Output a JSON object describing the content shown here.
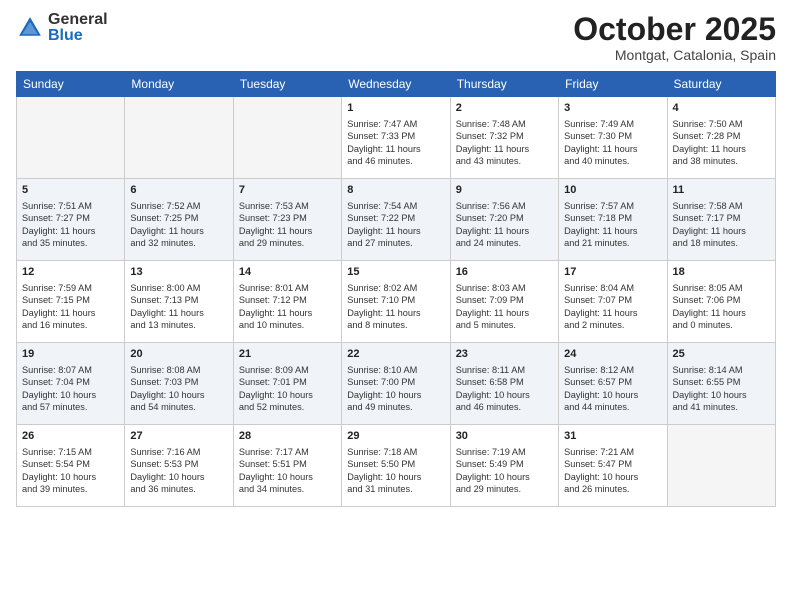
{
  "header": {
    "logo_general": "General",
    "logo_blue": "Blue",
    "month_title": "October 2025",
    "location": "Montgat, Catalonia, Spain"
  },
  "weekdays": [
    "Sunday",
    "Monday",
    "Tuesday",
    "Wednesday",
    "Thursday",
    "Friday",
    "Saturday"
  ],
  "weeks": [
    [
      {
        "day": "",
        "info": ""
      },
      {
        "day": "",
        "info": ""
      },
      {
        "day": "",
        "info": ""
      },
      {
        "day": "1",
        "info": "Sunrise: 7:47 AM\nSunset: 7:33 PM\nDaylight: 11 hours\nand 46 minutes."
      },
      {
        "day": "2",
        "info": "Sunrise: 7:48 AM\nSunset: 7:32 PM\nDaylight: 11 hours\nand 43 minutes."
      },
      {
        "day": "3",
        "info": "Sunrise: 7:49 AM\nSunset: 7:30 PM\nDaylight: 11 hours\nand 40 minutes."
      },
      {
        "day": "4",
        "info": "Sunrise: 7:50 AM\nSunset: 7:28 PM\nDaylight: 11 hours\nand 38 minutes."
      }
    ],
    [
      {
        "day": "5",
        "info": "Sunrise: 7:51 AM\nSunset: 7:27 PM\nDaylight: 11 hours\nand 35 minutes."
      },
      {
        "day": "6",
        "info": "Sunrise: 7:52 AM\nSunset: 7:25 PM\nDaylight: 11 hours\nand 32 minutes."
      },
      {
        "day": "7",
        "info": "Sunrise: 7:53 AM\nSunset: 7:23 PM\nDaylight: 11 hours\nand 29 minutes."
      },
      {
        "day": "8",
        "info": "Sunrise: 7:54 AM\nSunset: 7:22 PM\nDaylight: 11 hours\nand 27 minutes."
      },
      {
        "day": "9",
        "info": "Sunrise: 7:56 AM\nSunset: 7:20 PM\nDaylight: 11 hours\nand 24 minutes."
      },
      {
        "day": "10",
        "info": "Sunrise: 7:57 AM\nSunset: 7:18 PM\nDaylight: 11 hours\nand 21 minutes."
      },
      {
        "day": "11",
        "info": "Sunrise: 7:58 AM\nSunset: 7:17 PM\nDaylight: 11 hours\nand 18 minutes."
      }
    ],
    [
      {
        "day": "12",
        "info": "Sunrise: 7:59 AM\nSunset: 7:15 PM\nDaylight: 11 hours\nand 16 minutes."
      },
      {
        "day": "13",
        "info": "Sunrise: 8:00 AM\nSunset: 7:13 PM\nDaylight: 11 hours\nand 13 minutes."
      },
      {
        "day": "14",
        "info": "Sunrise: 8:01 AM\nSunset: 7:12 PM\nDaylight: 11 hours\nand 10 minutes."
      },
      {
        "day": "15",
        "info": "Sunrise: 8:02 AM\nSunset: 7:10 PM\nDaylight: 11 hours\nand 8 minutes."
      },
      {
        "day": "16",
        "info": "Sunrise: 8:03 AM\nSunset: 7:09 PM\nDaylight: 11 hours\nand 5 minutes."
      },
      {
        "day": "17",
        "info": "Sunrise: 8:04 AM\nSunset: 7:07 PM\nDaylight: 11 hours\nand 2 minutes."
      },
      {
        "day": "18",
        "info": "Sunrise: 8:05 AM\nSunset: 7:06 PM\nDaylight: 11 hours\nand 0 minutes."
      }
    ],
    [
      {
        "day": "19",
        "info": "Sunrise: 8:07 AM\nSunset: 7:04 PM\nDaylight: 10 hours\nand 57 minutes."
      },
      {
        "day": "20",
        "info": "Sunrise: 8:08 AM\nSunset: 7:03 PM\nDaylight: 10 hours\nand 54 minutes."
      },
      {
        "day": "21",
        "info": "Sunrise: 8:09 AM\nSunset: 7:01 PM\nDaylight: 10 hours\nand 52 minutes."
      },
      {
        "day": "22",
        "info": "Sunrise: 8:10 AM\nSunset: 7:00 PM\nDaylight: 10 hours\nand 49 minutes."
      },
      {
        "day": "23",
        "info": "Sunrise: 8:11 AM\nSunset: 6:58 PM\nDaylight: 10 hours\nand 46 minutes."
      },
      {
        "day": "24",
        "info": "Sunrise: 8:12 AM\nSunset: 6:57 PM\nDaylight: 10 hours\nand 44 minutes."
      },
      {
        "day": "25",
        "info": "Sunrise: 8:14 AM\nSunset: 6:55 PM\nDaylight: 10 hours\nand 41 minutes."
      }
    ],
    [
      {
        "day": "26",
        "info": "Sunrise: 7:15 AM\nSunset: 5:54 PM\nDaylight: 10 hours\nand 39 minutes."
      },
      {
        "day": "27",
        "info": "Sunrise: 7:16 AM\nSunset: 5:53 PM\nDaylight: 10 hours\nand 36 minutes."
      },
      {
        "day": "28",
        "info": "Sunrise: 7:17 AM\nSunset: 5:51 PM\nDaylight: 10 hours\nand 34 minutes."
      },
      {
        "day": "29",
        "info": "Sunrise: 7:18 AM\nSunset: 5:50 PM\nDaylight: 10 hours\nand 31 minutes."
      },
      {
        "day": "30",
        "info": "Sunrise: 7:19 AM\nSunset: 5:49 PM\nDaylight: 10 hours\nand 29 minutes."
      },
      {
        "day": "31",
        "info": "Sunrise: 7:21 AM\nSunset: 5:47 PM\nDaylight: 10 hours\nand 26 minutes."
      },
      {
        "day": "",
        "info": ""
      }
    ]
  ]
}
